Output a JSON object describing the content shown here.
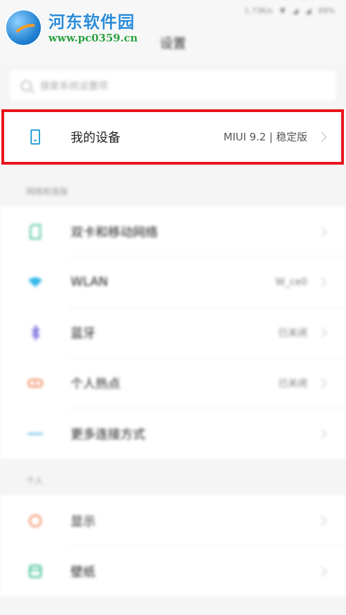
{
  "status_bar": {
    "speed": "1.73K/s",
    "battery": "49%"
  },
  "header": {
    "title": "设置"
  },
  "watermark": {
    "name": "河东软件园",
    "url": "www.pc0359.cn"
  },
  "search": {
    "placeholder": "搜索系统设置项"
  },
  "device": {
    "label": "我的设备",
    "value": "MIUI 9.2 | 稳定版"
  },
  "sections": {
    "network": {
      "label": "网络和连接",
      "items": [
        {
          "icon": "sim-card-icon",
          "label": "双卡和移动网络",
          "value": ""
        },
        {
          "icon": "wifi-icon",
          "label": "WLAN",
          "value": "W_ce0"
        },
        {
          "icon": "bluetooth-icon",
          "label": "蓝牙",
          "value": "已关闭"
        },
        {
          "icon": "hotspot-icon",
          "label": "个人热点",
          "value": "已关闭"
        },
        {
          "icon": "more-connections-icon",
          "label": "更多连接方式",
          "value": ""
        }
      ]
    },
    "personal": {
      "label": "个人",
      "items": [
        {
          "icon": "display-icon",
          "label": "显示",
          "value": ""
        },
        {
          "icon": "wallpaper-icon",
          "label": "壁纸",
          "value": ""
        }
      ]
    }
  },
  "colors": {
    "highlight": "#e8141b",
    "accent": "#2fa3d6"
  }
}
